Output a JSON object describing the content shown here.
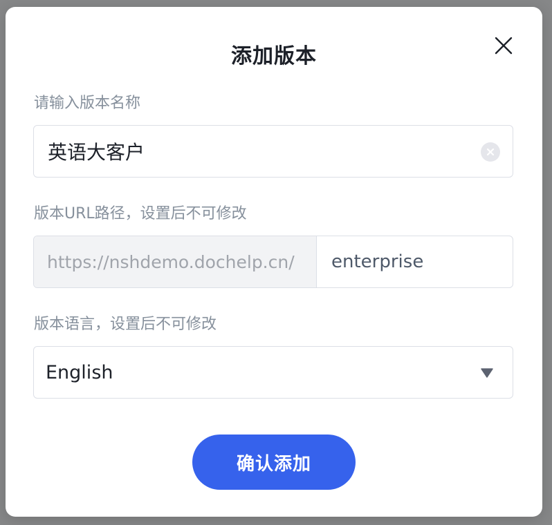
{
  "dialog": {
    "title": "添加版本",
    "close_icon": "close-icon"
  },
  "name_field": {
    "label": "请输入版本名称",
    "value": "英语大客户",
    "clear_icon": "clear-circle-icon"
  },
  "url_field": {
    "label": "版本URL路径，设置后不可修改",
    "prefix": "https://nshdemo.dochelp.cn/",
    "value": "enterprise"
  },
  "language_field": {
    "label": "版本语言，设置后不可修改",
    "selected": "English",
    "caret_icon": "caret-down-icon"
  },
  "confirm_button": {
    "label": "确认添加"
  },
  "colors": {
    "primary": "#3662ec",
    "label": "#86909c",
    "border": "#dcdfe6",
    "prefix_bg": "#f2f3f5"
  }
}
